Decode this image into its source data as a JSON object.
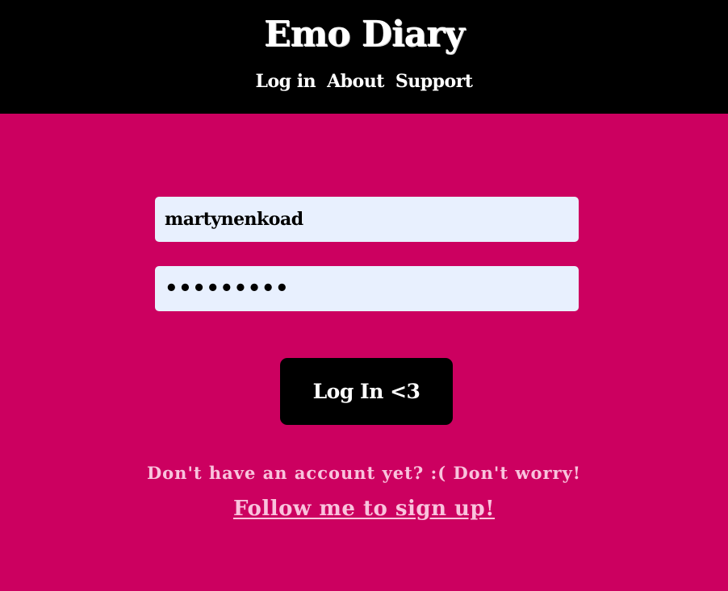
{
  "header": {
    "brand": "Emo Diary",
    "nav": [
      {
        "label": "Log in"
      },
      {
        "label": "About"
      },
      {
        "label": "Support"
      }
    ]
  },
  "login": {
    "username_value": "martynenkoad",
    "password_value": "•••••••••",
    "submit_label": "Log In <3"
  },
  "signup": {
    "hint": "Don't have an account yet? :( Don't worry!",
    "link": "Follow me to sign up!"
  },
  "colors": {
    "background": "#cc0060",
    "header": "#000000",
    "input_bg": "#e8f0fe",
    "hint_text": "#f9c3dd"
  }
}
